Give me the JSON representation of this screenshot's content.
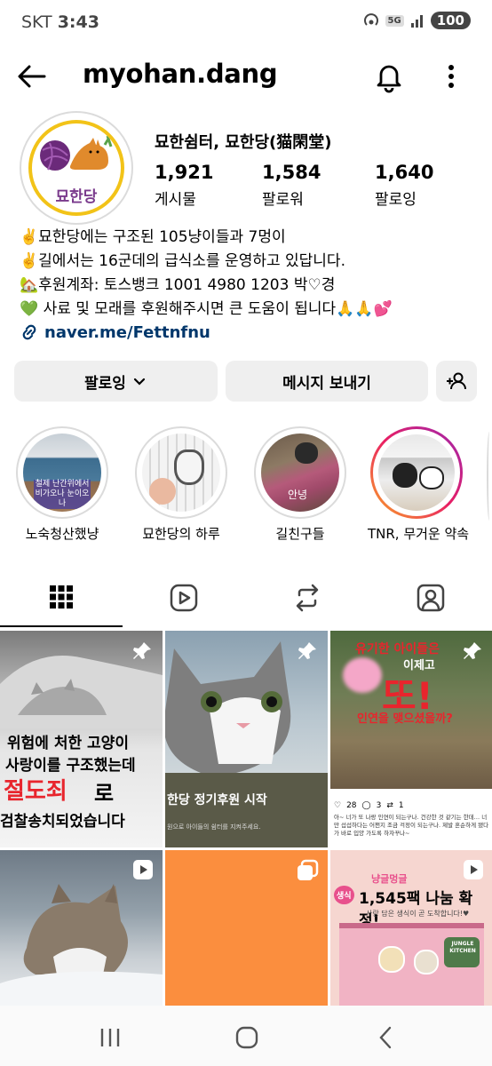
{
  "status_bar": {
    "carrier": "SKT",
    "time": "3:43",
    "network": "5G",
    "battery": "100"
  },
  "header": {
    "username": "myohan.dang"
  },
  "profile": {
    "full_name": "묘한쉼터, 묘한당(猫閑堂)",
    "avatar_text": "묘한당",
    "stats": [
      {
        "value": "1,921",
        "label": "게시물"
      },
      {
        "value": "1,584",
        "label": "팔로워"
      },
      {
        "value": "1,640",
        "label": "팔로잉"
      }
    ],
    "bio": [
      "✌️묘한당에는 구조된 105냥이들과 7멍이",
      "✌️길에서는 16군데의 급식소를 운영하고 있답니다.",
      "🏡후원계좌: 토스뱅크 1001 4980 1203 박♡경",
      "💚 사료 및 모래를 후원해주시면 큰 도움이 됩니다🙏🙏💕"
    ],
    "link": "naver.me/Fettnfnu"
  },
  "actions": {
    "following": "팔로잉",
    "message": "메시지 보내기"
  },
  "highlights": [
    {
      "label": "노숙청산했냥",
      "overlay": "철제 난간위에서 비가오나 눈이오나"
    },
    {
      "label": "묘한당의 하루"
    },
    {
      "label": "길친구들",
      "overlay": "안녕"
    },
    {
      "label": "TNR, 무거운 약속"
    }
  ],
  "posts": [
    {
      "line1": "위험에 처한 고양이",
      "line2": "사랑이를 구조했는데",
      "line3": "절도죄",
      "line3b": "로",
      "line4": "검찰송치되었습니다"
    },
    {
      "title": "한당 정기후원 시작",
      "sub": "원으로 아이들의 쉼터를 지켜주세요."
    },
    {
      "line1": "유기한 아이들은",
      "line2": "이제고",
      "line3": "또!",
      "line4": "인연을 맺으셨을까?",
      "likes": "28",
      "comments": "3",
      "reposts": "1",
      "caption": "아~ 너가 또 나랑 인연이 되는구나. 건강한 것 같기는 한데… 너만 섭섭하다는 어쩐지 조금 걱정이 되는구나. 제발 혼순하게 됐다가 바로 입양 가도록 하자꾸나~"
    },
    {},
    {},
    {
      "brand": "냥글멍글",
      "title": "1,545팩 나눔 확정!",
      "badge": "생식",
      "sub": "사랑 담은 생식이 곧 도착합니다!♥",
      "sign": "JUNGLE KITCHEN"
    }
  ],
  "colors": {
    "link": "#00376b",
    "button_bg": "#efefef",
    "avatar_ring": "#f2c318",
    "orange_post": "#fb8e3e",
    "red_text": "#e8252d"
  }
}
